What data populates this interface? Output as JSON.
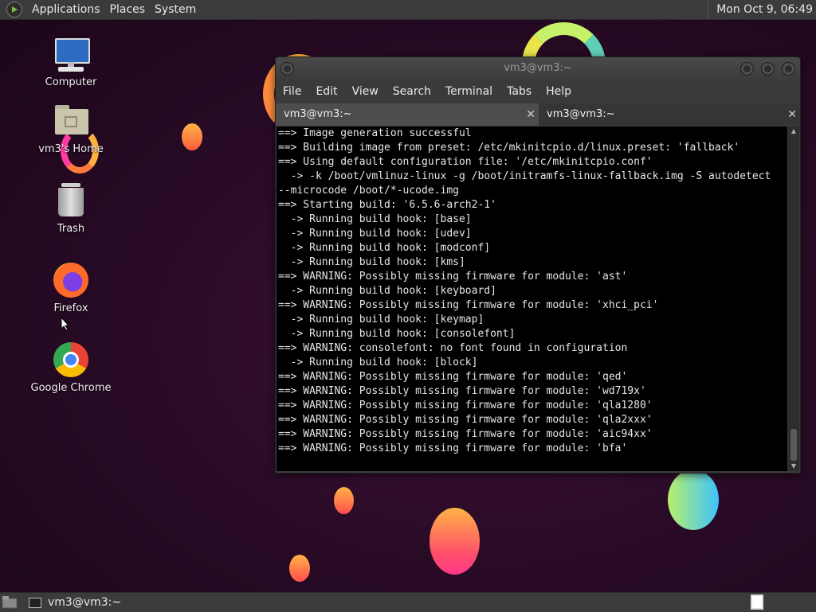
{
  "top_panel": {
    "menus": [
      "Applications",
      "Places",
      "System"
    ],
    "clock": "Mon Oct  9, 06:49"
  },
  "desktop_icons": [
    {
      "label": "Computer",
      "icon": "computer-icon"
    },
    {
      "label": "vm3's Home",
      "icon": "home-folder-icon"
    },
    {
      "label": "Trash",
      "icon": "trash-icon"
    },
    {
      "label": "Firefox",
      "icon": "firefox-icon"
    },
    {
      "label": "Google Chrome",
      "icon": "chrome-icon"
    }
  ],
  "terminal": {
    "title": "vm3@vm3:~",
    "menu": [
      "File",
      "Edit",
      "View",
      "Search",
      "Terminal",
      "Tabs",
      "Help"
    ],
    "tabs": [
      {
        "label": "vm3@vm3:~",
        "active": true
      },
      {
        "label": "vm3@vm3:~",
        "active": false
      }
    ],
    "lines": [
      "==> Image generation successful",
      "==> Building image from preset: /etc/mkinitcpio.d/linux.preset: 'fallback'",
      "==> Using default configuration file: '/etc/mkinitcpio.conf'",
      "  -> -k /boot/vmlinuz-linux -g /boot/initramfs-linux-fallback.img -S autodetect",
      "--microcode /boot/*-ucode.img",
      "==> Starting build: '6.5.6-arch2-1'",
      "  -> Running build hook: [base]",
      "  -> Running build hook: [udev]",
      "  -> Running build hook: [modconf]",
      "  -> Running build hook: [kms]",
      "==> WARNING: Possibly missing firmware for module: 'ast'",
      "  -> Running build hook: [keyboard]",
      "==> WARNING: Possibly missing firmware for module: 'xhci_pci'",
      "  -> Running build hook: [keymap]",
      "  -> Running build hook: [consolefont]",
      "==> WARNING: consolefont: no font found in configuration",
      "  -> Running build hook: [block]",
      "==> WARNING: Possibly missing firmware for module: 'qed'",
      "==> WARNING: Possibly missing firmware for module: 'wd719x'",
      "==> WARNING: Possibly missing firmware for module: 'qla1280'",
      "==> WARNING: Possibly missing firmware for module: 'qla2xxx'",
      "==> WARNING: Possibly missing firmware for module: 'aic94xx'",
      "==> WARNING: Possibly missing firmware for module: 'bfa'"
    ]
  },
  "taskbar": {
    "task_label": "vm3@vm3:~"
  },
  "colors": {
    "panel": "#3b3b3b",
    "terminal_bg": "#000000",
    "terminal_fg": "#e6e6e6",
    "desktop_bg": "#2a0b27"
  }
}
